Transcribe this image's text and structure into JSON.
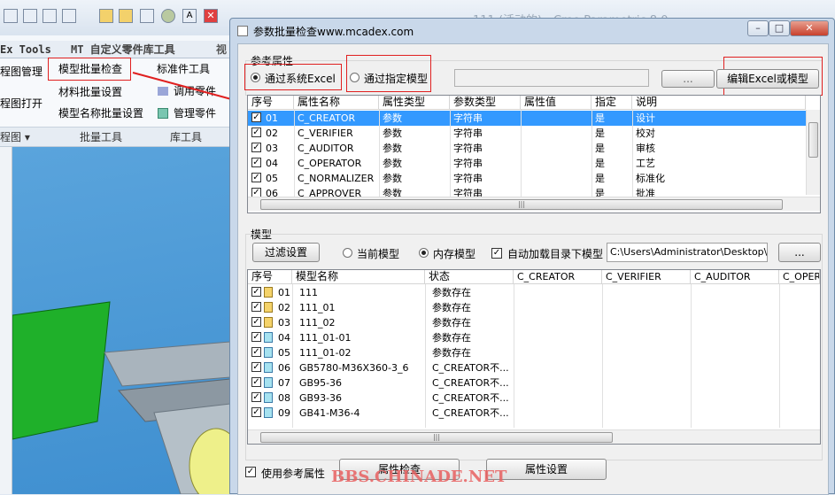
{
  "app_toolbar": {
    "title_text": "111 (活动的) - Creo Parametric 8.0"
  },
  "ribbon": {
    "tabs": [
      "Ex Tools",
      "MT 自定义零件库工具",
      "视"
    ],
    "items": {
      "drawing_mgmt": "程图管理",
      "drawing_open": "程图打开",
      "drawing_group": "程图 ▾",
      "model_batch_check": "模型批量检查",
      "material_batch": "材料批量设置",
      "model_name_batch": "模型名称批量设置",
      "standard_tool": "标准件工具",
      "call_part": "调用零件",
      "manage_part": "管理零件"
    },
    "groups": {
      "batch_tools": "批量工具",
      "lib_tools": "库工具"
    }
  },
  "dialog": {
    "title": "参数批量检查www.mcadex.com",
    "ref_group": "参考属性",
    "radio_excel": "通过系统Excel",
    "radio_model": "通过指定模型",
    "browse_label": "...",
    "edit_button": "编辑Excel或模型",
    "attr_headers": [
      "序号",
      "属性名称",
      "属性类型",
      "参数类型",
      "属性值",
      "指定",
      "说明"
    ],
    "attr_rows": [
      [
        "01",
        "C_CREATOR",
        "参数",
        "字符串",
        "",
        "是",
        "设计"
      ],
      [
        "02",
        "C_VERIFIER",
        "参数",
        "字符串",
        "",
        "是",
        "校对"
      ],
      [
        "03",
        "C_AUDITOR",
        "参数",
        "字符串",
        "",
        "是",
        "审核"
      ],
      [
        "04",
        "C_OPERATOR",
        "参数",
        "字符串",
        "",
        "是",
        "工艺"
      ],
      [
        "05",
        "C_NORMALIZER",
        "参数",
        "字符串",
        "",
        "是",
        "标准化"
      ],
      [
        "06",
        "C_APPROVER",
        "参数",
        "字符串",
        "",
        "是",
        "批准"
      ]
    ],
    "model_group": "模型",
    "filter_button": "过滤设置",
    "radio_current": "当前模型",
    "radio_memory": "内存模型",
    "auto_load_label": "自动加载目录下模型",
    "path_value": "C:\\Users\\Administrator\\Desktop\\ 测",
    "path_browse": "...",
    "model_headers": [
      "序号",
      "模型名称",
      "状态",
      "C_CREATOR",
      "C_VERIFIER",
      "C_AUDITOR",
      "C_OPERA"
    ],
    "model_rows": [
      {
        "no": "01",
        "name": "111",
        "status": "参数存在",
        "asm": true
      },
      {
        "no": "02",
        "name": "111_01",
        "status": "参数存在",
        "asm": true
      },
      {
        "no": "03",
        "name": "111_02",
        "status": "参数存在",
        "asm": true
      },
      {
        "no": "04",
        "name": "111_01-01",
        "status": "参数存在",
        "asm": false
      },
      {
        "no": "05",
        "name": "111_01-02",
        "status": "参数存在",
        "asm": false
      },
      {
        "no": "06",
        "name": "GB5780-M36X360-3_6",
        "status": "C_CREATOR不...",
        "asm": false
      },
      {
        "no": "07",
        "name": "GB95-36",
        "status": "C_CREATOR不...",
        "asm": false
      },
      {
        "no": "08",
        "name": "GB93-36",
        "status": "C_CREATOR不...",
        "asm": false
      },
      {
        "no": "09",
        "name": "GB41-M36-4",
        "status": "C_CREATOR不...",
        "asm": false
      }
    ],
    "use_ref_label": "使用参考属性",
    "check_button": "属性检查",
    "set_button": "属性设置"
  },
  "watermark": "BBS.CHINADE.NET",
  "colors": {
    "selection": "#3399ff",
    "accent_red": "#e02020",
    "viewport_blue": "#3f8fd0"
  }
}
